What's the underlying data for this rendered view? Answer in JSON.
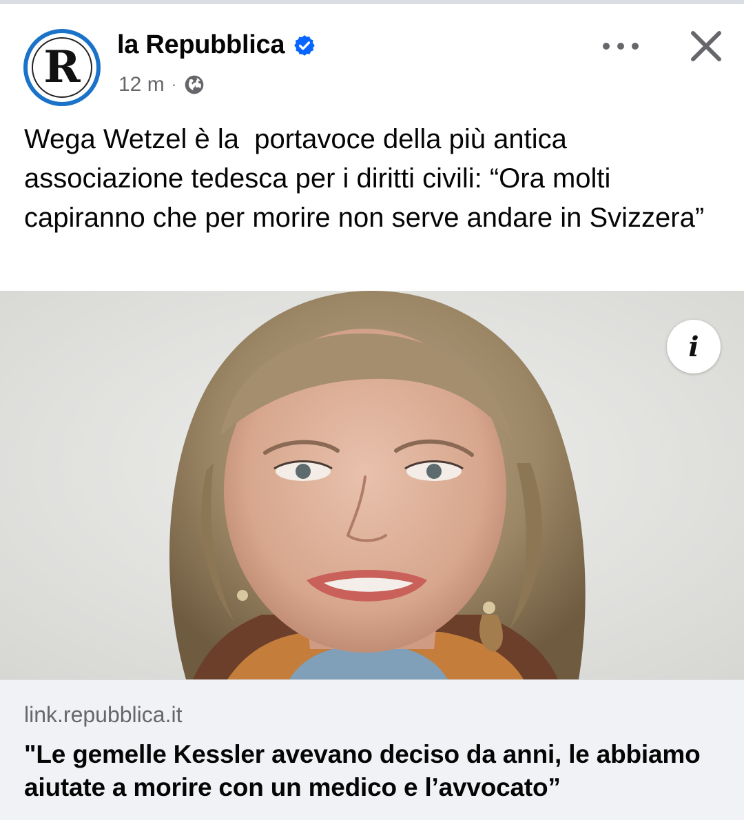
{
  "post": {
    "page_name": "la Repubblica",
    "avatar_letter": "R",
    "verified": true,
    "timestamp": "12 m",
    "separator": "·",
    "audience_icon": "globe-icon",
    "more_icon": "more-horizontal-icon",
    "close_icon": "close-icon",
    "caption": "Wega Wetzel è la  portavoce della più antica associazione tedesca per i diritti civili: “Ora molti capiranno che per morire non serve andare in Svizzera”"
  },
  "media": {
    "info_label": "i",
    "info_icon": "info-icon"
  },
  "link_preview": {
    "domain": "link.repubblica.it",
    "title": "\"Le gemelle Kessler avevano deciso da anni, le abbiamo aiutate a morire con un medico e l’avvocato”"
  },
  "colors": {
    "verified_blue": "#0866ff",
    "avatar_ring": "#1a73c9",
    "meta_gray": "#65676b",
    "preview_bg": "#f0f2f5"
  }
}
